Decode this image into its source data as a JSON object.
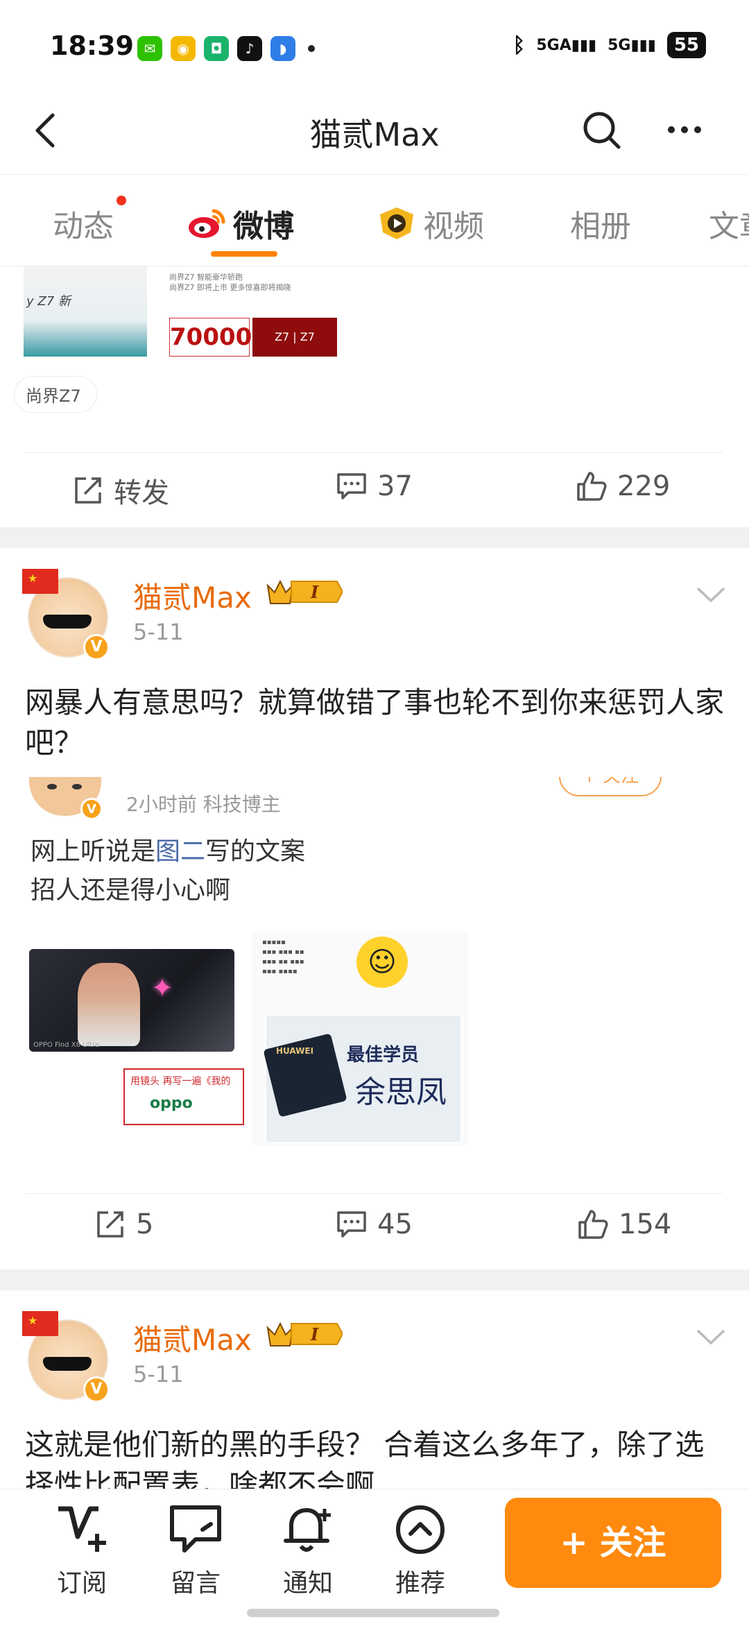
{
  "status_bar": {
    "time": "18:39",
    "signal1": "5GA",
    "signal2": "5G",
    "battery": "55"
  },
  "header": {
    "title": "猫贰Max"
  },
  "tabs": [
    {
      "label": "动态",
      "has_dot": true
    },
    {
      "label": "微博",
      "active": true
    },
    {
      "label": "视频"
    },
    {
      "label": "相册"
    },
    {
      "label": "文章"
    }
  ],
  "prev_post": {
    "topic": "尚界Z7",
    "price_text": "70000",
    "actions": {
      "repost_label": "转发",
      "comments": "37",
      "likes": "229"
    }
  },
  "posts": [
    {
      "author": "猫贰Max",
      "level": "I",
      "date": "5-11",
      "text": "网暴人有意思吗？就算做错了事也轮不到你来惩罚人家吧？",
      "quoted": {
        "meta": "2小时前  科技博主",
        "follow_label": "+ 关注",
        "text_before_link": "网上听说是",
        "link": "图二",
        "text_after_link": "写的文案",
        "text_line2": "招人还是得小心啊",
        "img1_caption": "用镜头 再写一遍《我的",
        "img1_brand": "oppo",
        "img2_title": "最佳学员",
        "img2_name": "余思凤",
        "img2_logo": "HUAWEI"
      },
      "actions": {
        "reposts": "5",
        "comments": "45",
        "likes": "154"
      }
    },
    {
      "author": "猫贰Max",
      "level": "I",
      "date": "5-11",
      "text": "这就是他们新的黑的手段？ 合着这么多年了，除了选择性比配置表，啥都不会啊"
    }
  ],
  "bottom_bar": {
    "items": [
      {
        "label": "订阅",
        "icon": "subscribe-icon"
      },
      {
        "label": "留言",
        "icon": "message-icon"
      },
      {
        "label": "通知",
        "icon": "bell-icon"
      },
      {
        "label": "推荐",
        "icon": "recommend-icon"
      }
    ],
    "follow_label": "+ 关注"
  },
  "colors": {
    "accent": "#ff8200",
    "author": "#e86b0c",
    "follow_button": "#ff8a0e"
  }
}
